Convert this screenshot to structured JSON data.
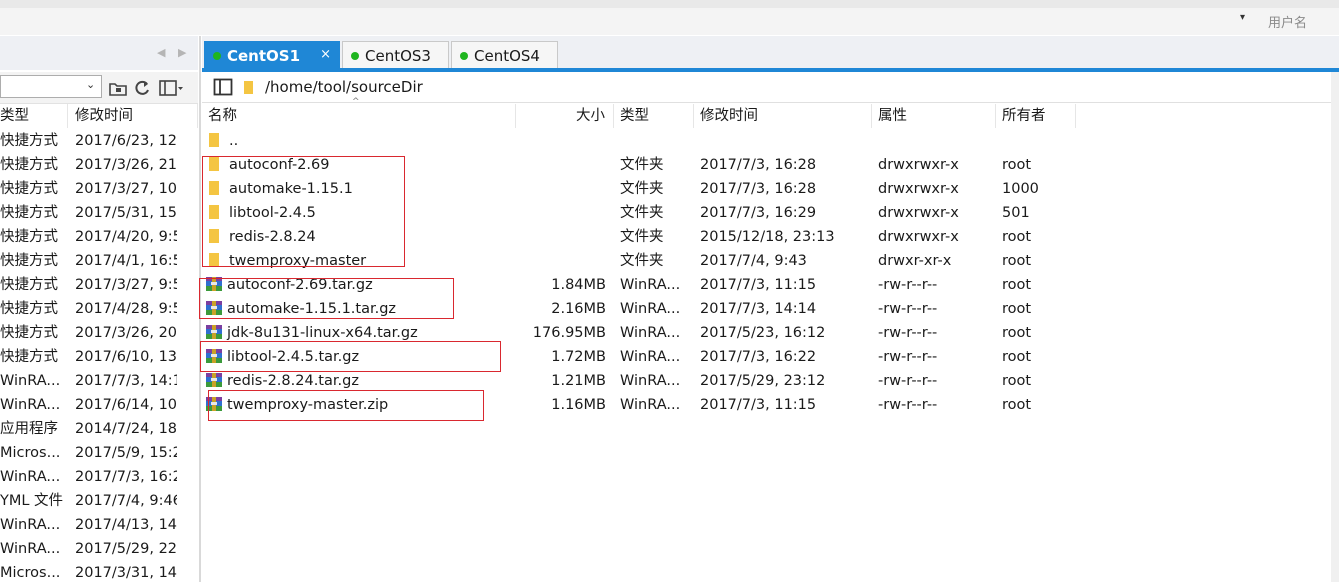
{
  "user": {
    "label": "用户名",
    "dropdown_glyph": "▾"
  },
  "nav": {
    "back": "◀",
    "forward": "▶"
  },
  "left_panel": {
    "columns": {
      "type": "类型",
      "modified": "修改时间"
    },
    "rows": [
      {
        "type": "快捷方式",
        "time": "2017/6/23, 12"
      },
      {
        "type": "快捷方式",
        "time": "2017/3/26, 21"
      },
      {
        "type": "快捷方式",
        "time": "2017/3/27, 10"
      },
      {
        "type": "快捷方式",
        "time": "2017/5/31, 15"
      },
      {
        "type": "快捷方式",
        "time": "2017/4/20, 9:5"
      },
      {
        "type": "快捷方式",
        "time": "2017/4/1, 16:5"
      },
      {
        "type": "快捷方式",
        "time": "2017/3/27, 9:5"
      },
      {
        "type": "快捷方式",
        "time": "2017/4/28, 9:5"
      },
      {
        "type": "快捷方式",
        "time": "2017/3/26, 20"
      },
      {
        "type": "快捷方式",
        "time": "2017/6/10, 13"
      },
      {
        "type": "WinRA...",
        "time": "2017/7/3, 14:1"
      },
      {
        "type": "WinRA...",
        "time": "2017/6/14, 10"
      },
      {
        "type": "应用程序",
        "time": "2014/7/24, 18"
      },
      {
        "type": "Micros...",
        "time": "2017/5/9, 15:2"
      },
      {
        "type": "WinRA...",
        "time": "2017/7/3, 16:2"
      },
      {
        "type": "YML 文件",
        "time": "2017/7/4, 9:46"
      },
      {
        "type": "WinRA...",
        "time": "2017/4/13, 14"
      },
      {
        "type": "WinRA...",
        "time": "2017/5/29, 22"
      },
      {
        "type": "Micros...",
        "time": "2017/3/31, 14"
      }
    ]
  },
  "tabs": [
    {
      "label": "CentOS1",
      "active": true,
      "close": "×"
    },
    {
      "label": "CentOS3",
      "active": false
    },
    {
      "label": "CentOS4",
      "active": false
    }
  ],
  "path": "/home/tool/sourceDir",
  "sort_indicator": "^",
  "columns": {
    "name": "名称",
    "size": "大小",
    "type": "类型",
    "modified": "修改时间",
    "perms": "属性",
    "owner": "所有者"
  },
  "files": [
    {
      "name": "..",
      "size": "",
      "type": "",
      "modified": "",
      "perms": "",
      "owner": "",
      "kind": "folder"
    },
    {
      "name": "autoconf-2.69",
      "size": "",
      "type": "文件夹",
      "modified": "2017/7/3, 16:28",
      "perms": "drwxrwxr-x",
      "owner": "root",
      "kind": "folder"
    },
    {
      "name": "automake-1.15.1",
      "size": "",
      "type": "文件夹",
      "modified": "2017/7/3, 16:28",
      "perms": "drwxrwxr-x",
      "owner": "1000",
      "kind": "folder"
    },
    {
      "name": "libtool-2.4.5",
      "size": "",
      "type": "文件夹",
      "modified": "2017/7/3, 16:29",
      "perms": "drwxrwxr-x",
      "owner": "501",
      "kind": "folder"
    },
    {
      "name": "redis-2.8.24",
      "size": "",
      "type": "文件夹",
      "modified": "2015/12/18, 23:13",
      "perms": "drwxrwxr-x",
      "owner": "root",
      "kind": "folder"
    },
    {
      "name": "twemproxy-master",
      "size": "",
      "type": "文件夹",
      "modified": "2017/7/4, 9:43",
      "perms": "drwxr-xr-x",
      "owner": "root",
      "kind": "folder"
    },
    {
      "name": "autoconf-2.69.tar.gz",
      "size": "1.84MB",
      "type": "WinRA...",
      "modified": "2017/7/3, 11:15",
      "perms": "-rw-r--r--",
      "owner": "root",
      "kind": "archive"
    },
    {
      "name": "automake-1.15.1.tar.gz",
      "size": "2.16MB",
      "type": "WinRA...",
      "modified": "2017/7/3, 14:14",
      "perms": "-rw-r--r--",
      "owner": "root",
      "kind": "archive"
    },
    {
      "name": "jdk-8u131-linux-x64.tar.gz",
      "size": "176.95MB",
      "type": "WinRA...",
      "modified": "2017/5/23, 16:12",
      "perms": "-rw-r--r--",
      "owner": "root",
      "kind": "archive"
    },
    {
      "name": "libtool-2.4.5.tar.gz",
      "size": "1.72MB",
      "type": "WinRA...",
      "modified": "2017/7/3, 16:22",
      "perms": "-rw-r--r--",
      "owner": "root",
      "kind": "archive"
    },
    {
      "name": "redis-2.8.24.tar.gz",
      "size": "1.21MB",
      "type": "WinRA...",
      "modified": "2017/5/29, 23:12",
      "perms": "-rw-r--r--",
      "owner": "root",
      "kind": "archive"
    },
    {
      "name": "twemproxy-master.zip",
      "size": "1.16MB",
      "type": "WinRA...",
      "modified": "2017/7/3, 11:15",
      "perms": "-rw-r--r--",
      "owner": "root",
      "kind": "archive"
    }
  ],
  "colors": {
    "accent": "#1f87d6",
    "tab_dot": "#1fb51f",
    "highlight_box": "#d9282f",
    "folder": "#f4c542"
  },
  "icons": [
    "folder-icon",
    "archive-icon",
    "new-folder-icon",
    "refresh-icon",
    "view-layout-icon",
    "panel-toggle-icon"
  ]
}
